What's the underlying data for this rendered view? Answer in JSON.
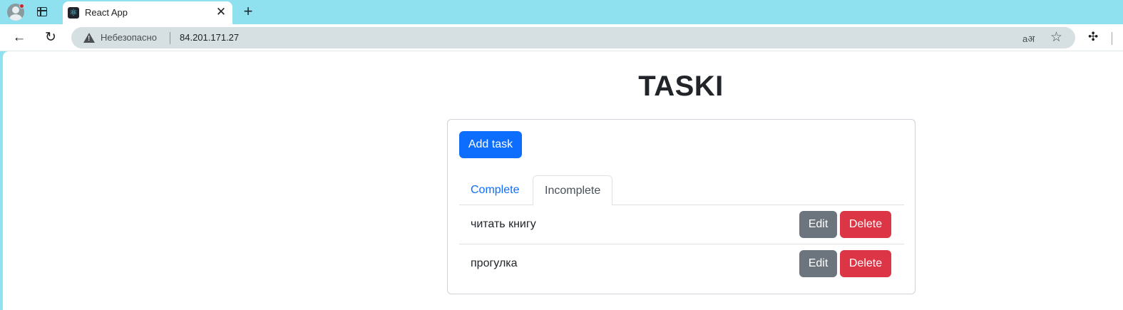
{
  "browser": {
    "tab_title": "React App",
    "tab_close": "✕",
    "new_tab": "+",
    "security_label": "Небезопасно",
    "url": "84.201.171.27",
    "read_aloud": "aअ"
  },
  "app": {
    "title": "TASKI",
    "add_button": "Add task",
    "tabs": [
      {
        "label": "Complete",
        "active": false
      },
      {
        "label": "Incomplete",
        "active": true
      }
    ],
    "tasks": [
      {
        "text": "читать книгу",
        "edit": "Edit",
        "delete": "Delete"
      },
      {
        "text": "прогулка",
        "edit": "Edit",
        "delete": "Delete"
      }
    ]
  },
  "colors": {
    "primary": "#0d6efd",
    "secondary": "#6c757d",
    "danger": "#dc3545",
    "browser_frame": "#8fe1ef"
  }
}
